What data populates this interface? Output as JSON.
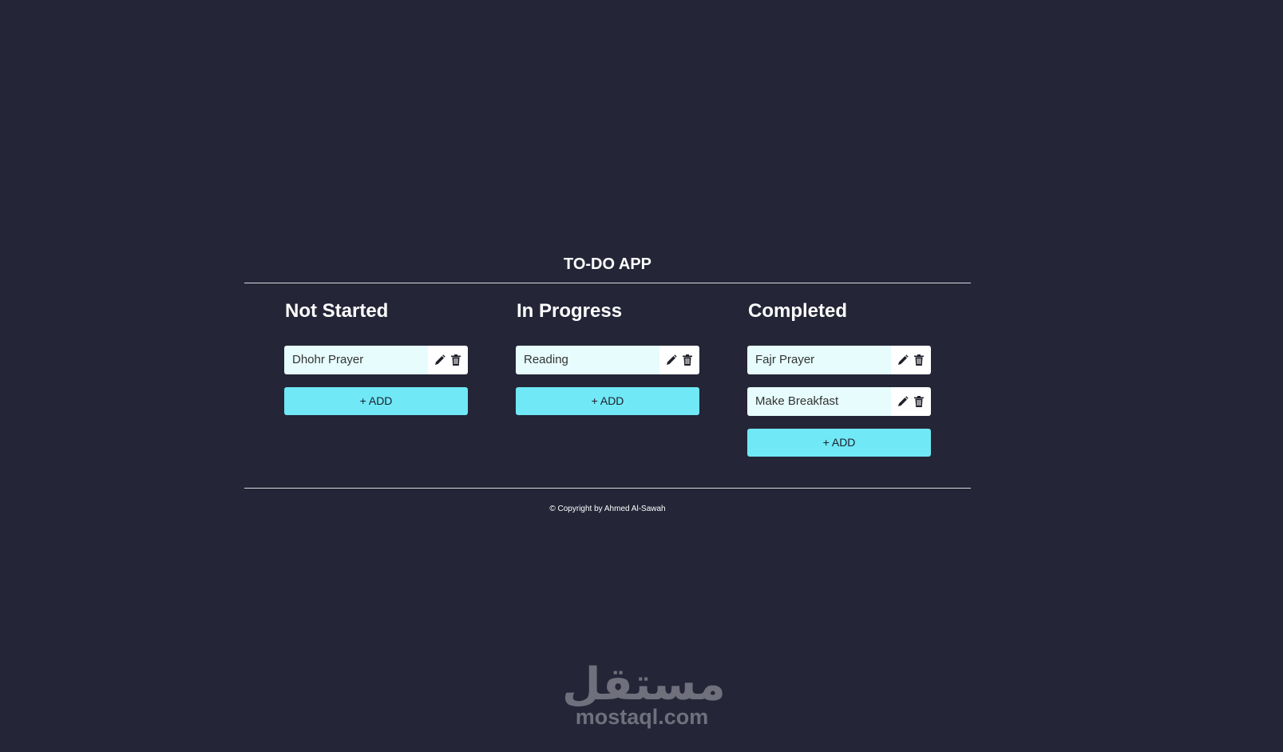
{
  "app": {
    "title": "TO-DO APP"
  },
  "columns": [
    {
      "title": "Not Started",
      "tasks": [
        "Dhohr Prayer"
      ],
      "add_label": "+ ADD"
    },
    {
      "title": "In Progress",
      "tasks": [
        "Reading"
      ],
      "add_label": "+ ADD"
    },
    {
      "title": "Completed",
      "tasks": [
        "Fajr Prayer",
        "Make Breakfast"
      ],
      "add_label": "+ ADD"
    }
  ],
  "footer": {
    "copyright": "© Copyright by Ahmed Al-Sawah"
  },
  "watermark": {
    "arabic": "مستقل",
    "latin": "mostaql.com"
  },
  "icons": {
    "edit": "pencil-icon",
    "delete": "trash-icon"
  },
  "colors": {
    "background": "#242537",
    "task_bg": "#e6fcfd",
    "add_button": "#70e8f6",
    "rule": "#d9d9d9"
  }
}
